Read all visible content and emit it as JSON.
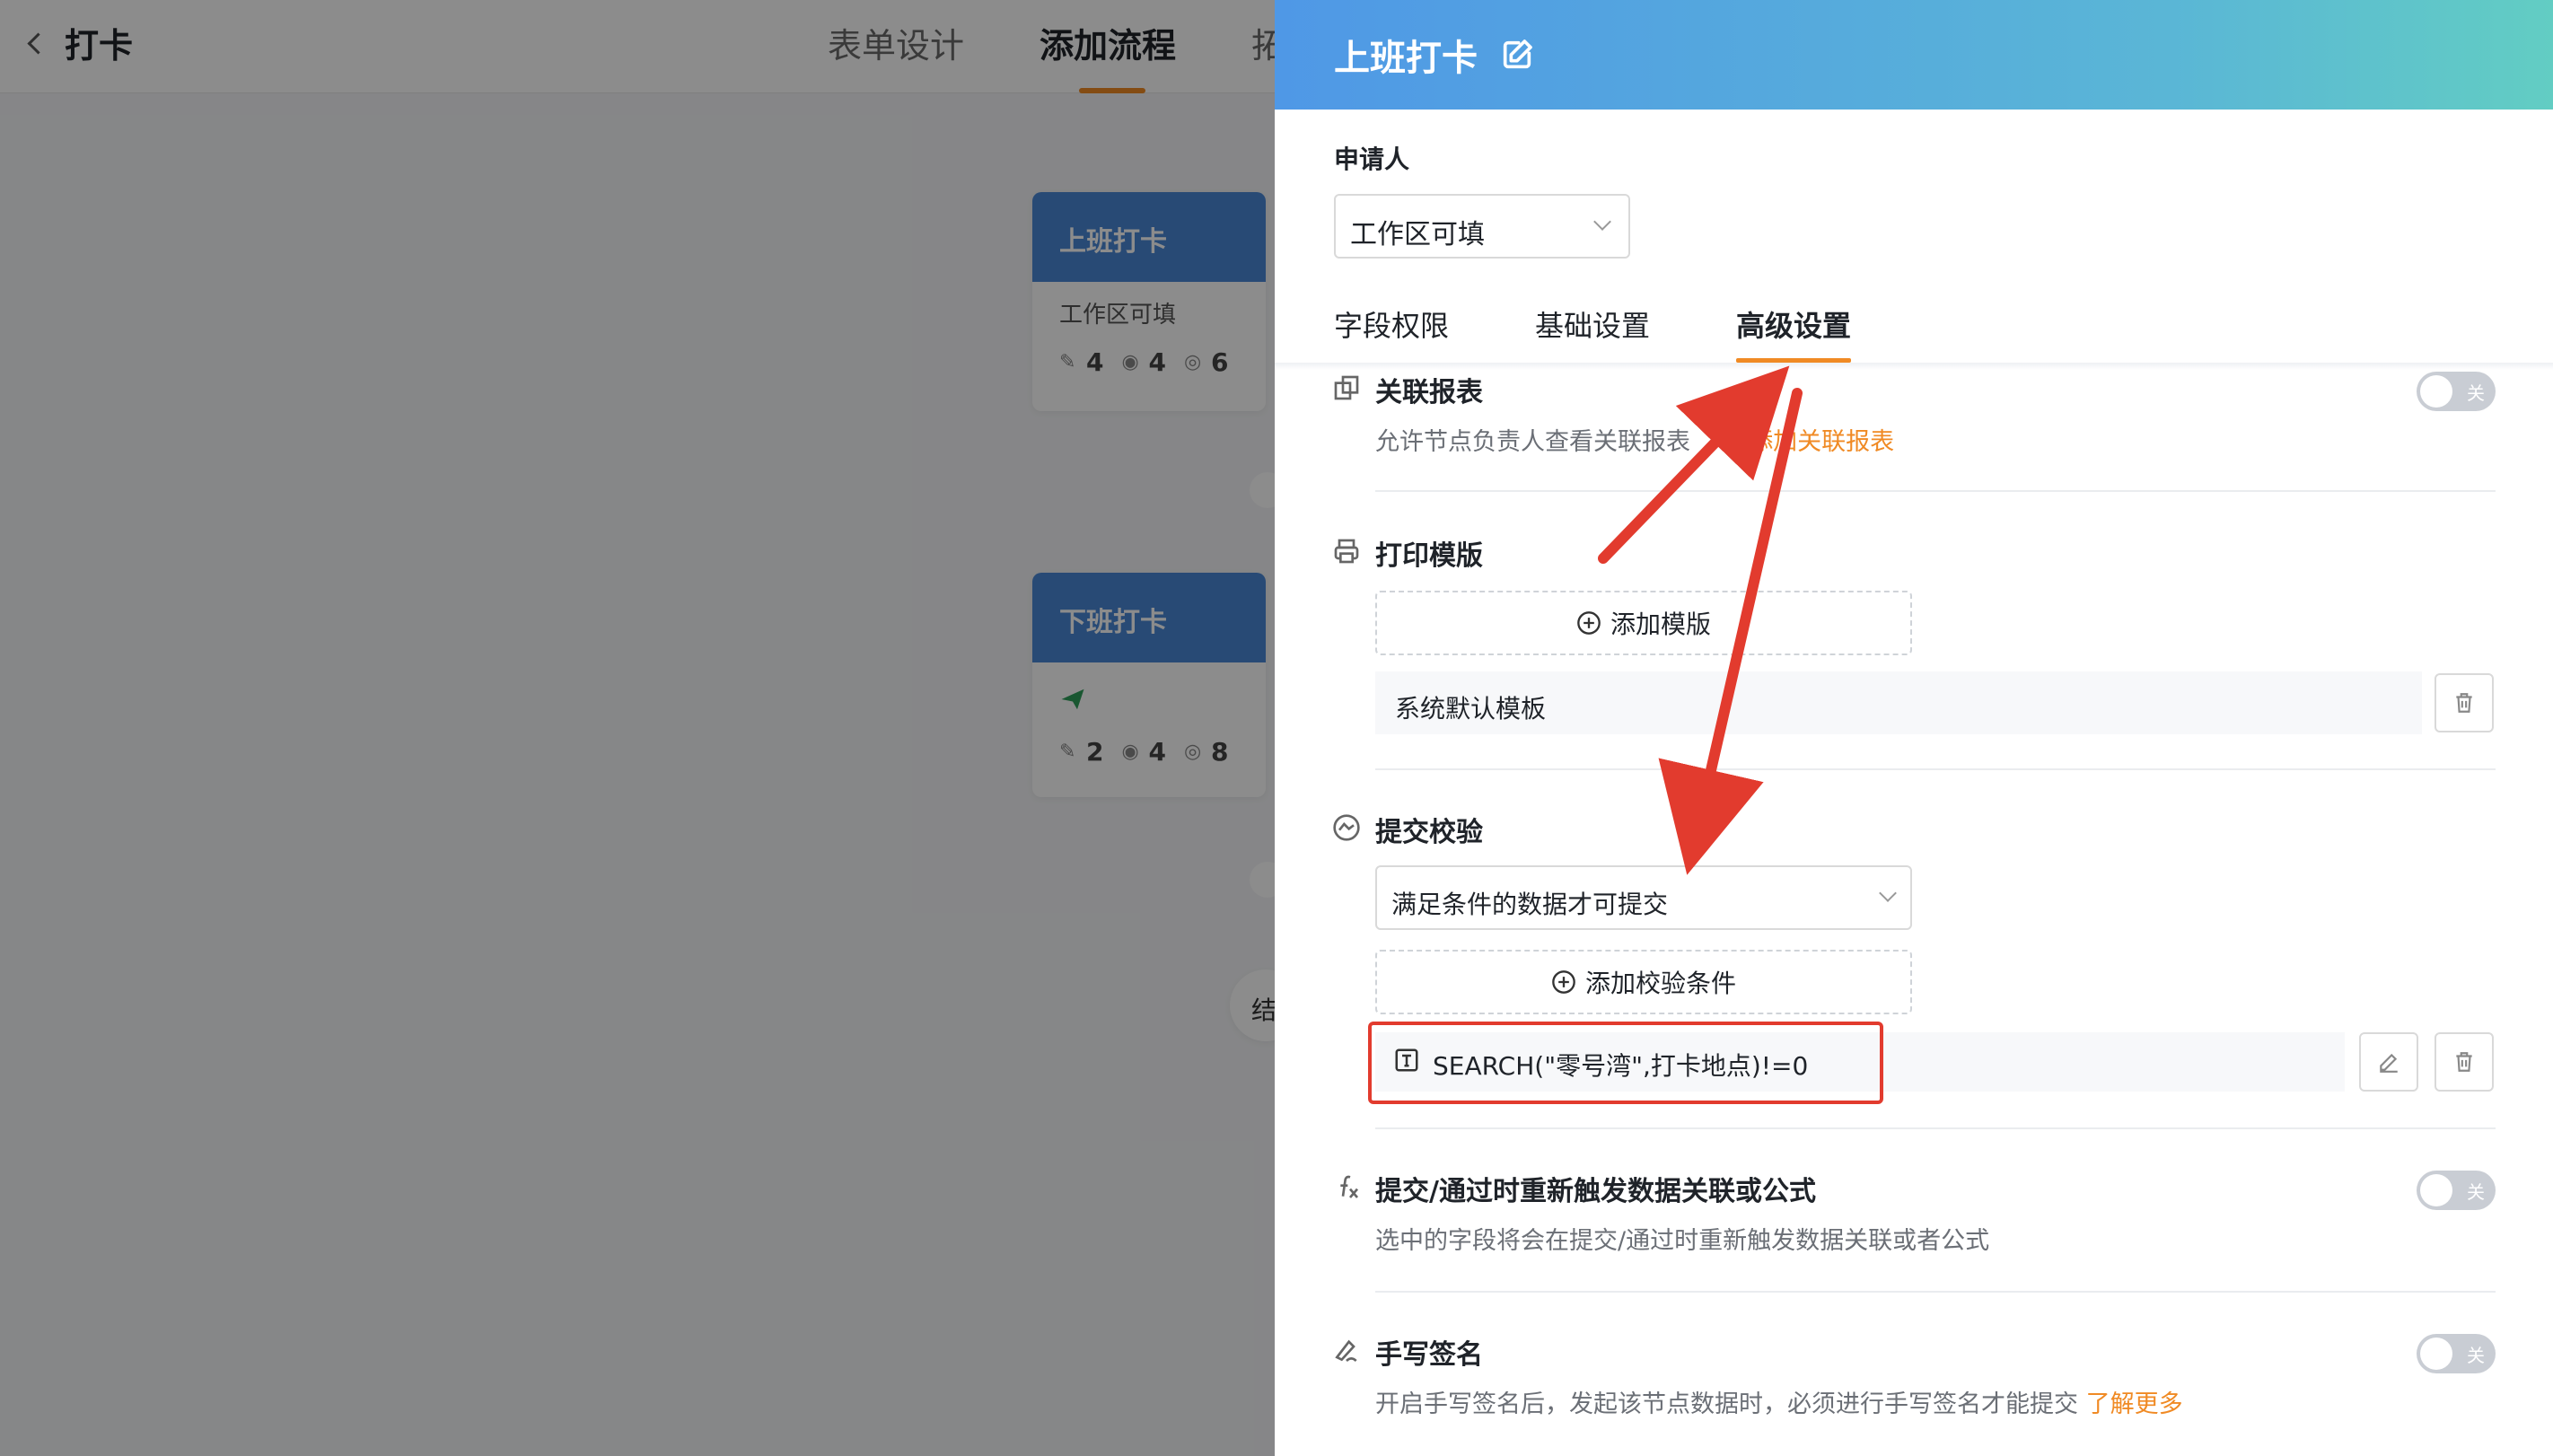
{
  "topbar": {
    "title": "打卡",
    "tabs": [
      {
        "label": "表单设计"
      },
      {
        "label": "添加流程"
      },
      {
        "label": "拓"
      }
    ]
  },
  "flow": {
    "card1": {
      "title": "上班打卡",
      "subtitle": "工作区可填",
      "stats": [
        "4",
        "4",
        "6"
      ]
    },
    "card2": {
      "title": "下班打卡",
      "stats": [
        "2",
        "4",
        "8"
      ]
    },
    "end_node": "结"
  },
  "drawer": {
    "title": "上班打卡",
    "applicant_label": "申请人",
    "applicant_value": "工作区可填",
    "tabs": [
      {
        "label": "字段权限"
      },
      {
        "label": "基础设置"
      },
      {
        "label": "高级设置"
      }
    ],
    "linked_report": {
      "title": "关联报表",
      "desc": "允许节点负责人查看关联报表",
      "link": "添加关联报表",
      "toggle": "关"
    },
    "print_template": {
      "title": "打印模版",
      "add_label": "添加模版",
      "item": "系统默认模板"
    },
    "submit_validation": {
      "title": "提交校验",
      "select_value": "满足条件的数据才可提交",
      "add_label": "添加校验条件",
      "formula": "SEARCH(\"零号湾\",打卡地点)!=0"
    },
    "retrigger": {
      "title": "提交/通过时重新触发数据关联或公式",
      "desc": "选中的字段将会在提交/通过时重新触发数据关联或者公式",
      "toggle": "关"
    },
    "signature": {
      "title": "手写签名",
      "desc": "开启手写签名后，发起该节点数据时，必须进行手写签名才能提交",
      "link": "了解更多",
      "toggle": "关"
    }
  },
  "colors": {
    "accent": "#f08a24",
    "highlight": "#e23b2e",
    "header_start": "#4f98e6",
    "header_end": "#62cdc3"
  }
}
